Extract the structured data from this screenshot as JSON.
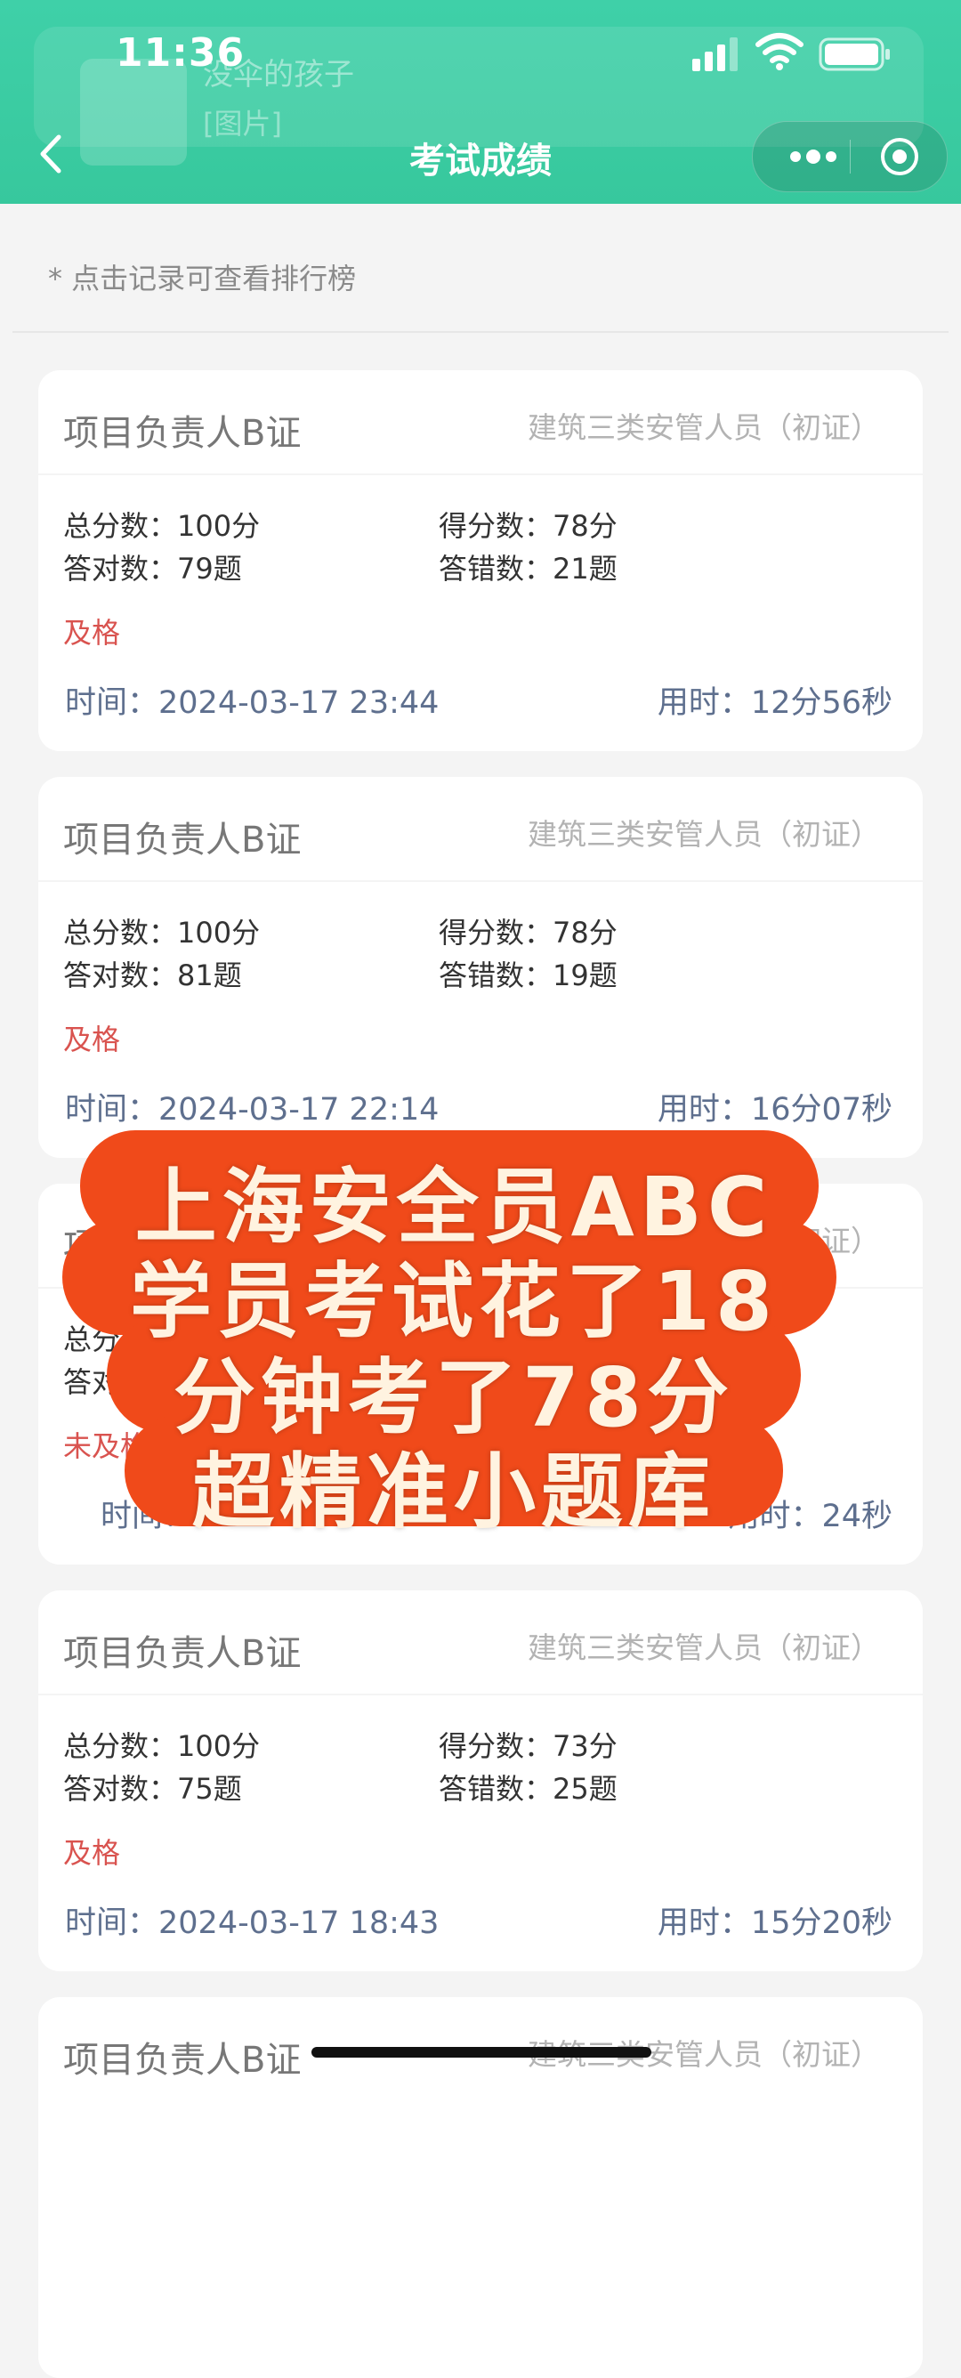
{
  "status_bar": {
    "time": "11:36"
  },
  "notification": {
    "title": "没伞的孩子",
    "subtitle": "[图片]"
  },
  "nav": {
    "title": "考试成绩"
  },
  "hint": "* 点击记录可查看排行榜",
  "labels": {
    "total": "总分数：",
    "score": "得分数：",
    "correct": "答对数：",
    "wrong": "答错数：",
    "time": "时间：",
    "duration": "用时："
  },
  "records": [
    {
      "title": "项目负责人B证",
      "category": "建筑三类安管人员（初证）",
      "total": "100分",
      "score": "78分",
      "correct": "79题",
      "wrong": "21题",
      "status": "及格",
      "time": "2024-03-17 23:44",
      "duration": "12分56秒"
    },
    {
      "title": "项目负责人B证",
      "category": "建筑三类安管人员（初证）",
      "total": "100分",
      "score": "78分",
      "correct": "81题",
      "wrong": "19题",
      "status": "及格",
      "time": "2024-03-17 22:14",
      "duration": "16分07秒"
    },
    {
      "title": "项",
      "category": "（初证）",
      "total": "",
      "score": "",
      "correct": "",
      "wrong": "",
      "status": "未及格",
      "time": "",
      "duration": "24秒"
    },
    {
      "title": "项目负责人B证",
      "category": "建筑三类安管人员（初证）",
      "total": "100分",
      "score": "73分",
      "correct": "75题",
      "wrong": "25题",
      "status": "及格",
      "time": "2024-03-17 18:43",
      "duration": "15分20秒"
    },
    {
      "title": "项目负责人B证",
      "category": "建筑三类安管人员（初证）"
    }
  ],
  "banner": {
    "line1": "上海安全员ABC",
    "line2": "学员考试花了18",
    "line3": "分钟考了78分",
    "line4": "超精准小题库"
  },
  "colors": {
    "header": "#3fd0a8",
    "banner": "#f04a1a",
    "status": "#d9534f"
  }
}
